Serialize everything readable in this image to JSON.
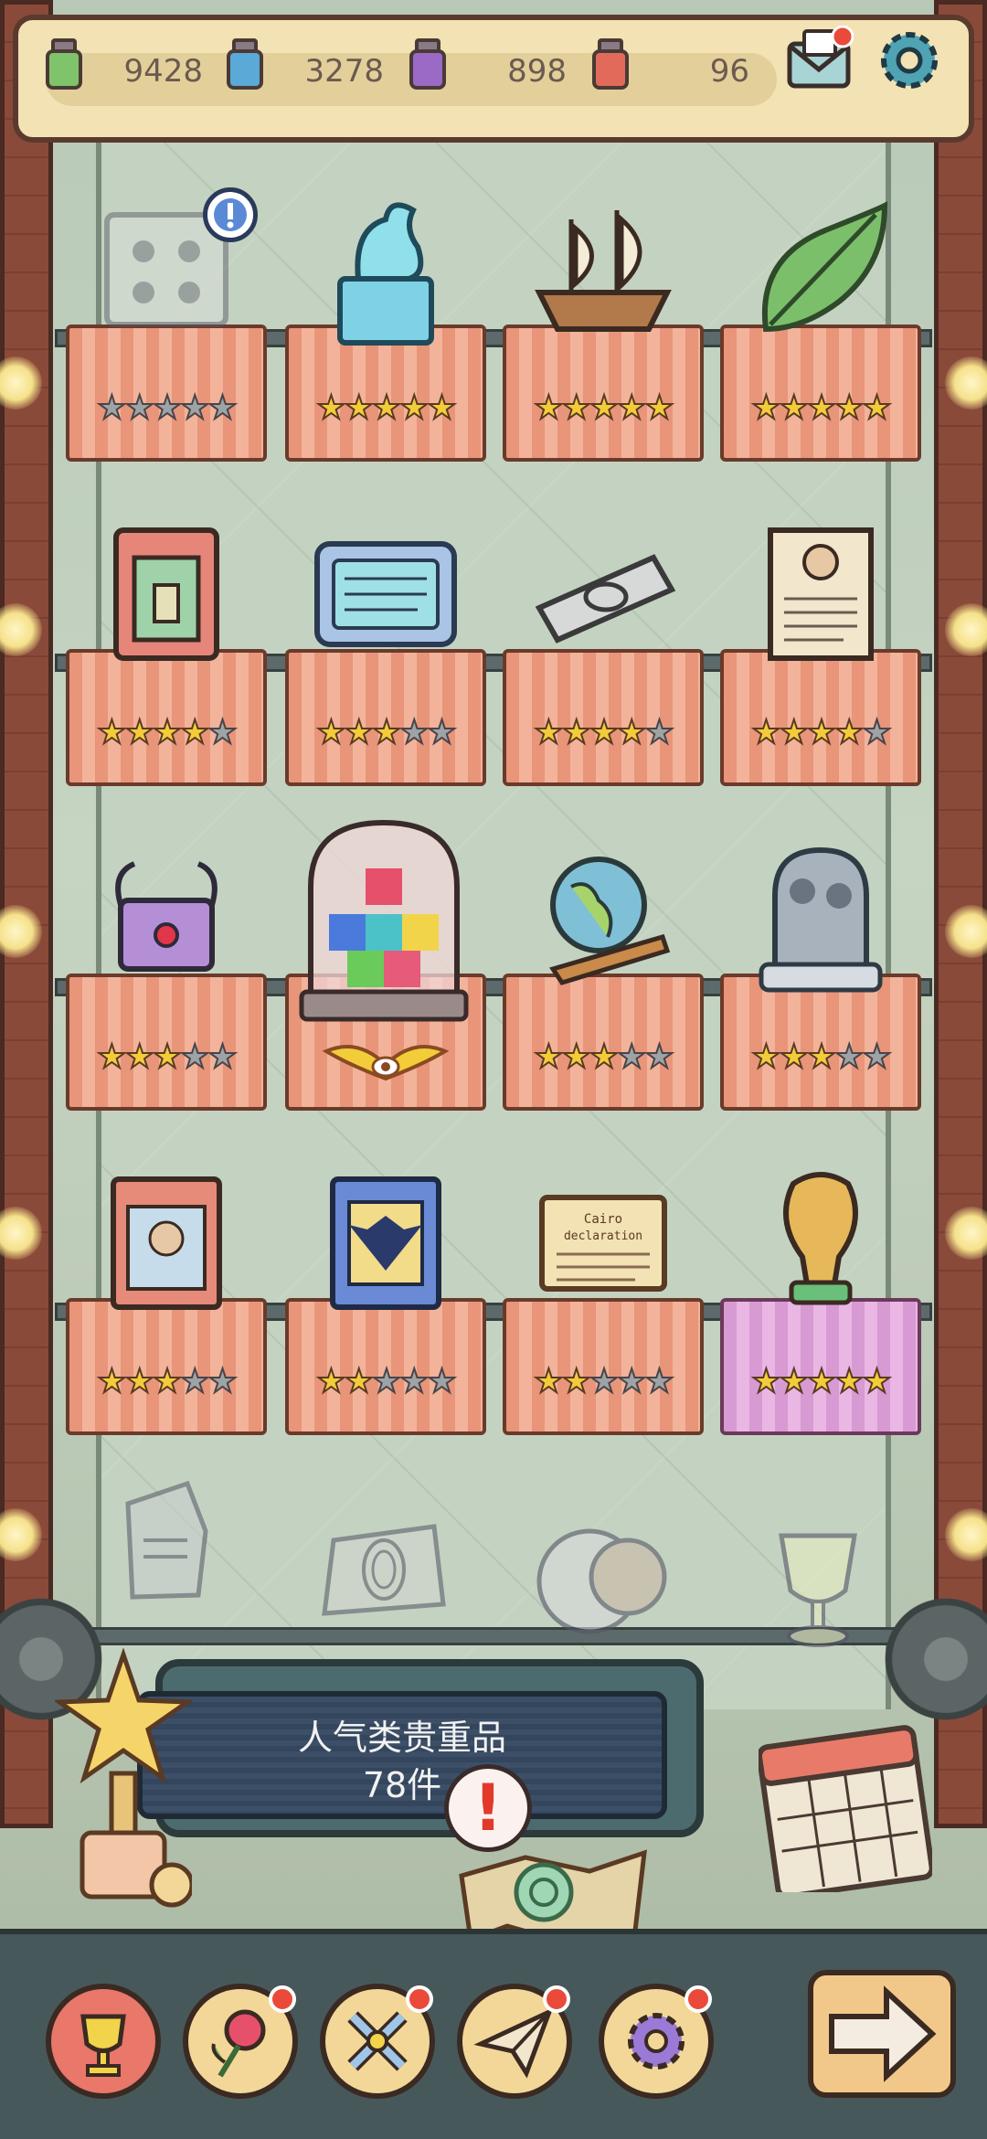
{
  "topbar": {
    "resources": [
      {
        "name": "green-ink-jar",
        "value": "9428",
        "color": "#7fc36a"
      },
      {
        "name": "blue-ink-jar",
        "value": "3278",
        "color": "#5aa9d6"
      },
      {
        "name": "purple-ink-jar",
        "value": "898",
        "color": "#9a6ac6"
      },
      {
        "name": "red-ink-jar",
        "value": "96",
        "color": "#e16a5a"
      }
    ],
    "mail_icon": "envelope-icon",
    "settings_icon": "gear-icon"
  },
  "shelves": [
    [
      {
        "item": "bug-specimen-frame",
        "stars": 0,
        "max": 5,
        "cloth": "orange",
        "new_badge": true
      },
      {
        "item": "dragon-statue",
        "stars": 5,
        "max": 5,
        "cloth": "orange"
      },
      {
        "item": "sailing-ship-model",
        "stars": 5,
        "max": 5,
        "cloth": "orange"
      },
      {
        "item": "green-leaf",
        "stars": 5,
        "max": 5,
        "cloth": "orange"
      }
    ],
    [
      {
        "item": "ancient-tablet",
        "stars": 4,
        "max": 5,
        "cloth": "orange"
      },
      {
        "item": "inscribed-stone",
        "stars": 3,
        "max": 5,
        "cloth": "orange"
      },
      {
        "item": "scroll-roll",
        "stars": 4,
        "max": 5,
        "cloth": "orange"
      },
      {
        "item": "declaration-document",
        "stars": 4,
        "max": 5,
        "cloth": "orange"
      }
    ],
    [
      {
        "item": "dragon-chest",
        "stars": 3,
        "max": 5,
        "cloth": "orange"
      },
      {
        "item": "tetris-dome",
        "stars": 0,
        "max": 5,
        "cloth": "orange",
        "special": "winged-eye-emblem"
      },
      {
        "item": "globe-on-stand",
        "stars": 3,
        "max": 5,
        "cloth": "orange"
      },
      {
        "item": "sculpture-group",
        "stars": 3,
        "max": 5,
        "cloth": "orange"
      }
    ],
    [
      {
        "item": "portrait-book",
        "stars": 3,
        "max": 5,
        "cloth": "orange"
      },
      {
        "item": "eagle-book",
        "stars": 2,
        "max": 5,
        "cloth": "orange"
      },
      {
        "item": "cairo-declaration-plaque",
        "stars": 2,
        "max": 5,
        "cloth": "orange",
        "plaque_text": "Cairo declaration"
      },
      {
        "item": "golden-world-cup",
        "stars": 5,
        "max": 5,
        "cloth": "pink"
      }
    ]
  ],
  "bottom_row_items": [
    "stone-fragment",
    "fingerprint-slab",
    "coin-portrait",
    "glass-goblet"
  ],
  "console": {
    "title": "人气类贵重品",
    "count": "78件"
  },
  "nav": [
    {
      "icon": "trophy-cup-icon",
      "active": true,
      "dot": false
    },
    {
      "icon": "rose-icon",
      "active": false,
      "dot": true
    },
    {
      "icon": "cross-badge-icon",
      "active": false,
      "dot": true
    },
    {
      "icon": "paper-plane-icon",
      "active": false,
      "dot": true
    },
    {
      "icon": "gear-flower-icon",
      "active": false,
      "dot": true
    }
  ],
  "next_icon": "arrow-right-icon"
}
